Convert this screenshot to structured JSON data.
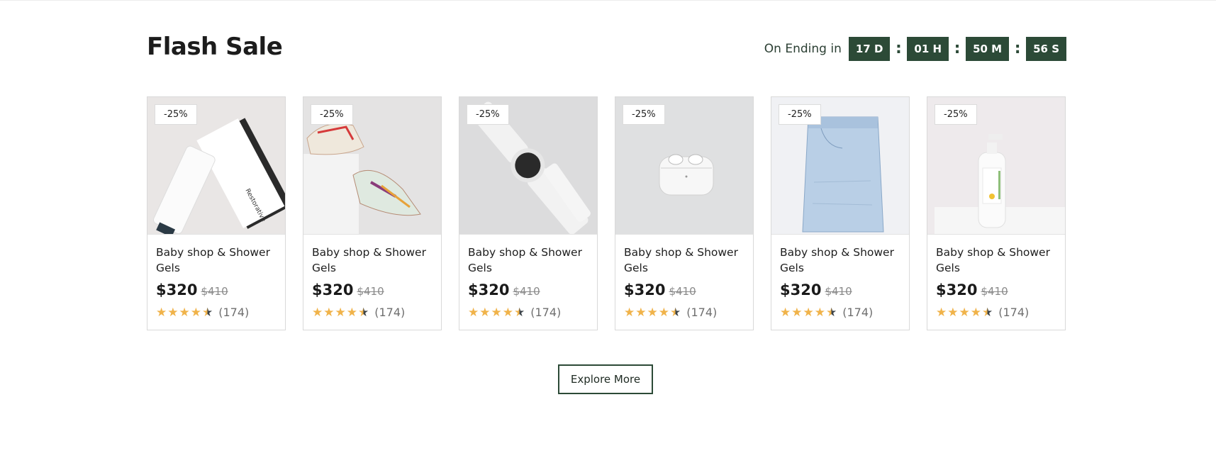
{
  "section": {
    "title": "Flash Sale",
    "countdown": {
      "label": "On Ending in",
      "days": "17 D",
      "hours": "01 H",
      "minutes": "50 M",
      "seconds": "56 S",
      "separator": ":"
    },
    "explore_label": "Explore More"
  },
  "colors": {
    "accent": "#2c4a37",
    "star": "#f0b34a"
  },
  "products": [
    {
      "image_icon": "hair-mask-icon",
      "discount": "-25%",
      "name": "Baby shop & Shower Gels",
      "price": "$320",
      "old_price": "$410",
      "rating": 4.5,
      "reviews": "(174)"
    },
    {
      "image_icon": "sneakers-icon",
      "discount": "-25%",
      "name": "Baby shop & Shower Gels",
      "price": "$320",
      "old_price": "$410",
      "rating": 4.5,
      "reviews": "(174)"
    },
    {
      "image_icon": "smartwatch-icon",
      "discount": "-25%",
      "name": "Baby shop & Shower Gels",
      "price": "$320",
      "old_price": "$410",
      "rating": 4.5,
      "reviews": "(174)"
    },
    {
      "image_icon": "earbuds-icon",
      "discount": "-25%",
      "name": "Baby shop & Shower Gels",
      "price": "$320",
      "old_price": "$410",
      "rating": 4.5,
      "reviews": "(174)"
    },
    {
      "image_icon": "jeans-icon",
      "discount": "-25%",
      "name": "Baby shop & Shower Gels",
      "price": "$320",
      "old_price": "$410",
      "rating": 4.5,
      "reviews": "(174)"
    },
    {
      "image_icon": "lotion-bottle-icon",
      "discount": "-25%",
      "name": "Baby shop & Shower Gels",
      "price": "$320",
      "old_price": "$410",
      "rating": 4.5,
      "reviews": "(174)"
    }
  ]
}
